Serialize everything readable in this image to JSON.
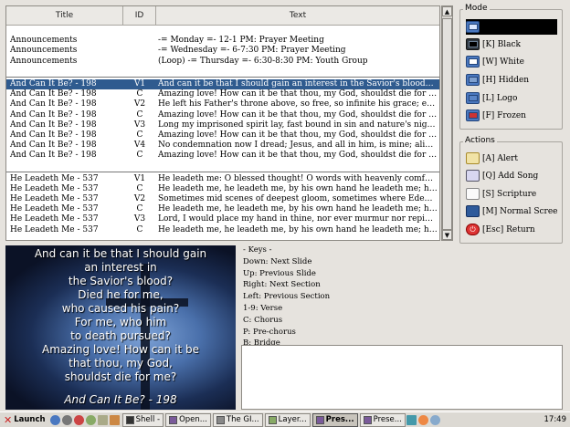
{
  "table": {
    "headers": {
      "title": "Title",
      "id": "ID",
      "text": "Text"
    },
    "announcements": [
      {
        "title": "Announcements",
        "id": "",
        "text": "-= Monday =- 12-1 PM: Prayer Meeting"
      },
      {
        "title": "Announcements",
        "id": "",
        "text": "-= Wednesday =- 6-7:30 PM: Prayer Meeting"
      },
      {
        "title": "Announcements",
        "id": "",
        "text": "(Loop) -= Thursday =- 6:30-8:30 PM: Youth Group"
      }
    ],
    "song1": [
      {
        "title": "And Can It Be? - 198",
        "id": "V1",
        "text": "And can it be that I should gain an interest in the Savior's blood? Died he f...",
        "selected": true
      },
      {
        "title": "And Can It Be? - 198",
        "id": "C",
        "text": "Amazing love! How can it be that thou, my God, shouldst die for me?"
      },
      {
        "title": "And Can It Be? - 198",
        "id": "V2",
        "text": "He left his Father's throne above, so free, so infinite his grace; emptied hi..."
      },
      {
        "title": "And Can It Be? - 198",
        "id": "C",
        "text": "Amazing love! How can it be that thou, my God, shouldst die for me?"
      },
      {
        "title": "And Can It Be? - 198",
        "id": "V3",
        "text": "Long my imprisoned spirit lay, fast bound in sin and nature's night; thine e..."
      },
      {
        "title": "And Can It Be? - 198",
        "id": "C",
        "text": "Amazing love! How can it be that thou, my God, shouldst die for me?"
      },
      {
        "title": "And Can It Be? - 198",
        "id": "V4",
        "text": "No condemnation now I dread; Jesus, and all in him, is mine; alive in him, ..."
      },
      {
        "title": "And Can It Be? - 198",
        "id": "C",
        "text": "Amazing love! How can it be that thou, my God, shouldst die for me?"
      }
    ],
    "song2": [
      {
        "title": "He Leadeth Me - 537",
        "id": "V1",
        "text": "He leadeth me: O blessed thought! O words with heavenly comfort fraugh..."
      },
      {
        "title": "He Leadeth Me - 537",
        "id": "C",
        "text": "He leadeth me, he leadeth me, by his own hand he leadeth me; his faithful..."
      },
      {
        "title": "He Leadeth Me - 537",
        "id": "V2",
        "text": "Sometimes mid scenes of deepest gloom, sometimes where Eden's bowers ..."
      },
      {
        "title": "He Leadeth Me - 537",
        "id": "C",
        "text": "He leadeth me, he leadeth me, by his own hand he leadeth me; his faithful..."
      },
      {
        "title": "He Leadeth Me - 537",
        "id": "V3",
        "text": "Lord, I would place my hand in thine, nor ever murmur nor repine; conte..."
      },
      {
        "title": "He Leadeth Me - 537",
        "id": "C",
        "text": "He leadeth me, he leadeth me, by his own hand he leadeth me; his faithful..."
      }
    ]
  },
  "mode": {
    "title": "Mode",
    "items": [
      {
        "label": "",
        "icon": "monitor-icon",
        "active": true
      },
      {
        "label": "[K] Black",
        "icon": "black-screen-icon"
      },
      {
        "label": "[W] White",
        "icon": "white-screen-icon"
      },
      {
        "label": "[H] Hidden",
        "icon": "hidden-screen-icon"
      },
      {
        "label": "[L] Logo",
        "icon": "logo-screen-icon"
      },
      {
        "label": "[F] Frozen",
        "icon": "frozen-screen-icon"
      }
    ]
  },
  "actions": {
    "title": "Actions",
    "items": [
      {
        "label": "[A] Alert",
        "icon": "alert-icon"
      },
      {
        "label": "[Q] Add Song",
        "icon": "add-song-icon"
      },
      {
        "label": "[S] Scripture",
        "icon": "scripture-icon"
      },
      {
        "label": "[M] Normal Scree",
        "icon": "normal-screen-icon"
      },
      {
        "label": "[Esc] Return",
        "icon": "return-icon"
      }
    ]
  },
  "preview": {
    "lyrics": [
      "And can it be that I should gain",
      "an interest in",
      "the Savior's blood?",
      "Died he for me,",
      "who caused his pain?",
      "For me, who him",
      "to death pursued?",
      "Amazing love! How can it be",
      "that thou, my God,",
      "shouldst die for me?"
    ],
    "caption": "And Can It Be? - 198"
  },
  "keys": {
    "heading": "- Keys -",
    "lines": [
      "Down: Next Slide",
      "Up: Previous Slide",
      "Right: Next Section",
      "Left: Previous Section",
      "1-9: Verse",
      "C: Chorus",
      "P: Pre-chorus",
      "B: Bridge"
    ]
  },
  "taskbar": {
    "launch": "Launch",
    "tasks": [
      {
        "label": "Shell -",
        "active": false
      },
      {
        "label": "Open...",
        "active": false
      },
      {
        "label": "The GI...",
        "active": false
      },
      {
        "label": "Layer...",
        "active": false
      },
      {
        "label": "Pres...",
        "active": true
      },
      {
        "label": "Prese...",
        "active": false
      }
    ],
    "clock": "17:49"
  },
  "colors": {
    "selection": "#2f5b8f",
    "mode_active": "#000000",
    "window_bg": "#e6e3de"
  }
}
